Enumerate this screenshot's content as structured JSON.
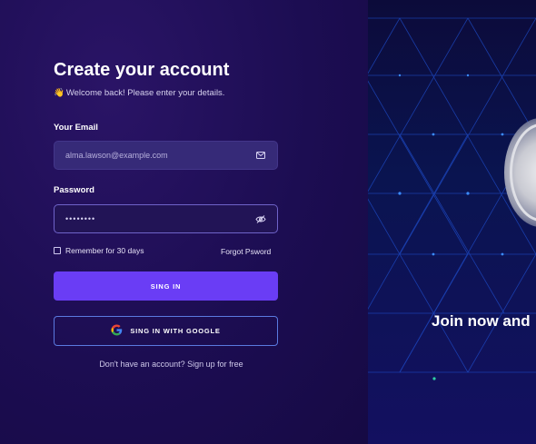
{
  "form": {
    "title": "Create your account",
    "wave_emoji": "👋",
    "subtitle": "Welcome back! Please enter your details.",
    "email_label": "Your Email",
    "email_value": "alma.lawson@example.com",
    "password_label": "Password",
    "password_value": "••••••••",
    "remember_label": "Remember for 30 days",
    "remember_checked": false,
    "forgot_label": "Forgot Psword",
    "signin_label": "SING IN",
    "google_label": "SING IN WITH GOOGLE",
    "signup_prefix": "Don't have an account?",
    "signup_link": "Sign up for free"
  },
  "icons": {
    "email": "mail-icon",
    "password": "eye-off-icon",
    "google": "google-icon"
  },
  "promo": {
    "headline": "Join now and"
  },
  "colors": {
    "primary_button": "#6a3df5",
    "left_bg": "#1c0d52",
    "right_bg": "#0a1450",
    "network_lines": "#1f4fd0",
    "google_border": "#5a7ae0"
  }
}
